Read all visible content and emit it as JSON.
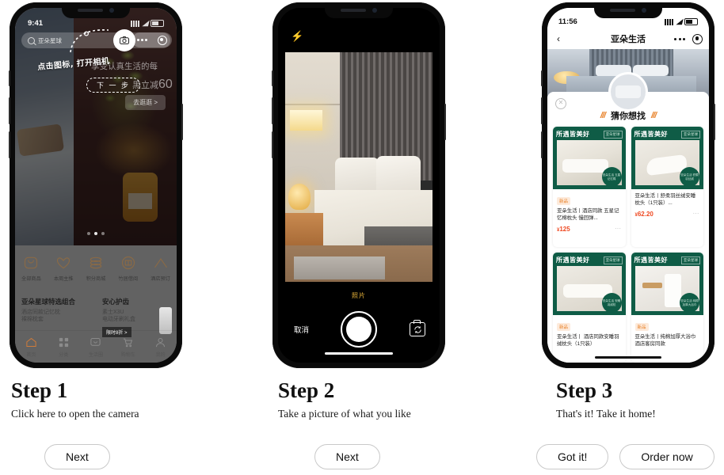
{
  "steps": [
    {
      "heading": "Step 1",
      "caption": "Click here to open the camera",
      "buttons": [
        {
          "label": "Next",
          "name": "next-button-step1"
        }
      ]
    },
    {
      "heading": "Step 2",
      "caption": "Take a picture of what you like",
      "buttons": [
        {
          "label": "Next",
          "name": "next-button-step2"
        }
      ]
    },
    {
      "heading": "Step 3",
      "caption": "That's it! Take it home!",
      "buttons": [
        {
          "label": "Got it!",
          "name": "got-it-button"
        },
        {
          "label": "Order now",
          "name": "order-now-button"
        }
      ]
    }
  ],
  "phone1": {
    "status": {
      "time": "9:41"
    },
    "search_placeholder": "亚朵星球",
    "annotation_text": "点击图标, 打开相机",
    "annotation_button": "下 一 步",
    "promo_line": "享受认真生活的每",
    "promo_line2": "黑立减",
    "promo_amount": "60",
    "promo_cta": "去逛逛 >",
    "carousel_dots": 3,
    "carousel_active_index": 1,
    "icon_nav": [
      {
        "label": "全部商品",
        "icon": "bag-icon"
      },
      {
        "label": "本周主推",
        "icon": "heart-icon"
      },
      {
        "label": "积分商城",
        "icon": "coins-icon"
      },
      {
        "label": "竹居借阅",
        "icon": "book-icon"
      },
      {
        "label": "酒店预订",
        "icon": "tent-icon"
      }
    ],
    "promo_cards": [
      {
        "title": "亚朵星球特选组合",
        "sub1": "酒店同款记忆枕",
        "sub2": "裸棉枕套",
        "tag": ""
      },
      {
        "title": "安心护齿",
        "sub1": "素士X3U",
        "sub2": "电动牙刷礼盒",
        "tag": "限时8折 >"
      }
    ],
    "tabbar": [
      {
        "label": "首页",
        "icon": "home-icon"
      },
      {
        "label": "分类",
        "icon": "grid-icon"
      },
      {
        "label": "生活圈",
        "icon": "chat-icon"
      },
      {
        "label": "购物车",
        "icon": "cart-icon"
      },
      {
        "label": "我的",
        "icon": "person-icon"
      }
    ]
  },
  "phone2": {
    "flash_icon": "lightning-icon",
    "mode_label": "照片",
    "cancel_label": "取消",
    "shutter_name": "shutter-button",
    "flip_icon": "camera-flip-icon"
  },
  "phone3": {
    "status": {
      "time": "11:56"
    },
    "nav_title": "亚朵生活",
    "back_icon": "chevron-left-icon",
    "close_icon": "close-circle-icon",
    "section_title": "猜你想找",
    "section_accent": "///",
    "products": [
      {
        "badge_title": "所遇皆美好",
        "badge_sub": "亚朵星球",
        "seal": "亚朵生活 五星记忆棉",
        "new_tag": "新品",
        "title": "亚朵生活丨酒店同款 五星记忆棉枕头 慢回弹...",
        "price_symbol": "¥",
        "price": "125",
        "more": "..."
      },
      {
        "badge_title": "所遇皆美好",
        "badge_sub": "亚朵星球",
        "seal": "亚朵生活 舒柔羽丝绒",
        "new_tag": "",
        "title": "亚朵生活丨舒柔羽丝绒安睡枕头（1只装）...",
        "price_symbol": "¥",
        "price": "62.20",
        "more": "..."
      },
      {
        "badge_title": "所遇皆美好",
        "badge_sub": "亚朵星球",
        "seal": "亚朵生活 安睡羽绒枕",
        "new_tag": "新品",
        "title": "亚朵生活丨 酒店同款安睡羽绒枕头（1只装）",
        "price_symbol": "",
        "price": "",
        "more": ""
      },
      {
        "badge_title": "所遇皆美好",
        "badge_sub": "亚朵星球",
        "seal": "亚朵生活 纯棉加厚大浴巾",
        "new_tag": "新品",
        "title": "亚朵生活丨纯棉加厚大浴巾 酒店客房同款",
        "price_symbol": "",
        "price": "",
        "more": ""
      }
    ]
  },
  "colors": {
    "accent_orange": "#e8822a",
    "price_red": "#ef4a23",
    "card_green": "#0f5c46",
    "camera_mode_yellow": "#e8b33a"
  }
}
